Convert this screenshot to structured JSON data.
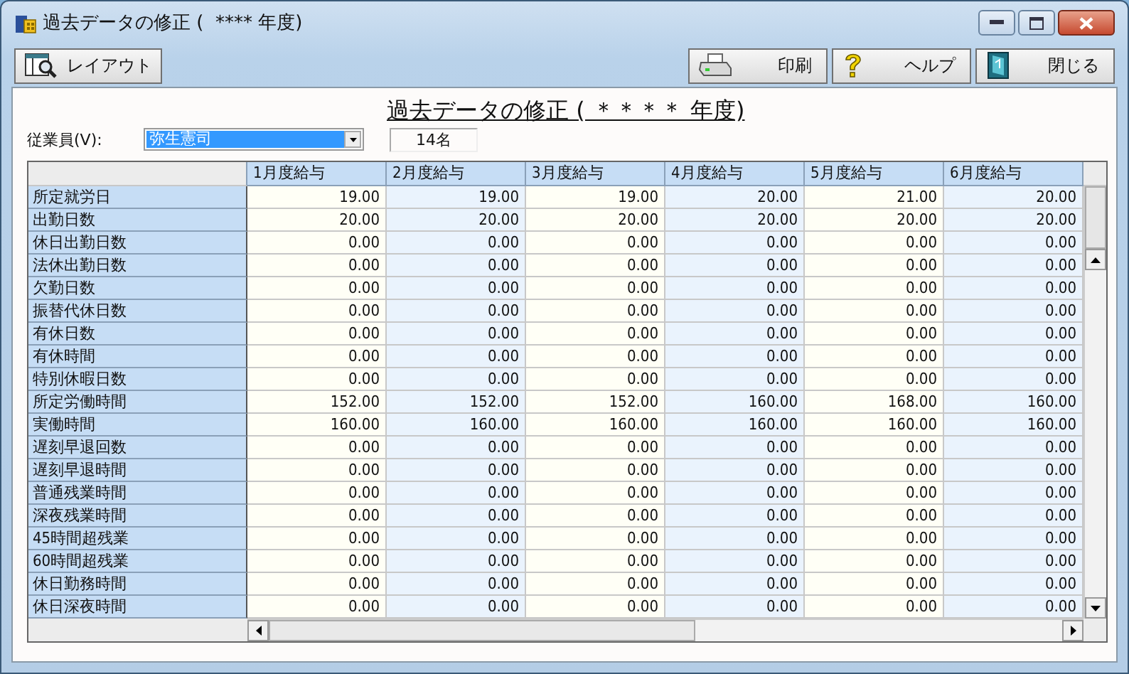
{
  "window": {
    "title": "過去データの修正 (  **** 年度)"
  },
  "toolbar": {
    "buttons": [
      {
        "kind": "layout",
        "label": "レイアウト"
      },
      {
        "kind": "print",
        "label": "印刷"
      },
      {
        "kind": "help",
        "label": "ヘルプ"
      },
      {
        "kind": "close",
        "label": "閉じる"
      }
    ]
  },
  "heading": "過去データの修正 ( ＊＊＊＊ 年度)",
  "employee": {
    "label": "従業員(V):",
    "value": "弥生憲司",
    "highlighted": true
  },
  "count": "14名",
  "table": {
    "columns": [
      "1月度給与",
      "2月度給与",
      "3月度給与",
      "4月度給与",
      "5月度給与",
      "6月度給与"
    ],
    "rows": [
      {
        "label": "所定就労日",
        "values": [
          "19.00",
          "19.00",
          "19.00",
          "20.00",
          "21.00",
          "20.00"
        ]
      },
      {
        "label": "出勤日数",
        "values": [
          "20.00",
          "20.00",
          "20.00",
          "20.00",
          "20.00",
          "20.00"
        ]
      },
      {
        "label": "休日出勤日数",
        "values": [
          "0.00",
          "0.00",
          "0.00",
          "0.00",
          "0.00",
          "0.00"
        ]
      },
      {
        "label": "法休出勤日数",
        "values": [
          "0.00",
          "0.00",
          "0.00",
          "0.00",
          "0.00",
          "0.00"
        ]
      },
      {
        "label": "欠勤日数",
        "values": [
          "0.00",
          "0.00",
          "0.00",
          "0.00",
          "0.00",
          "0.00"
        ]
      },
      {
        "label": "振替代休日数",
        "values": [
          "0.00",
          "0.00",
          "0.00",
          "0.00",
          "0.00",
          "0.00"
        ]
      },
      {
        "label": "有休日数",
        "values": [
          "0.00",
          "0.00",
          "0.00",
          "0.00",
          "0.00",
          "0.00"
        ]
      },
      {
        "label": "有休時間",
        "values": [
          "0.00",
          "0.00",
          "0.00",
          "0.00",
          "0.00",
          "0.00"
        ]
      },
      {
        "label": "特別休暇日数",
        "values": [
          "0.00",
          "0.00",
          "0.00",
          "0.00",
          "0.00",
          "0.00"
        ]
      },
      {
        "label": "所定労働時間",
        "values": [
          "152.00",
          "152.00",
          "152.00",
          "160.00",
          "168.00",
          "160.00"
        ]
      },
      {
        "label": "実働時間",
        "values": [
          "160.00",
          "160.00",
          "160.00",
          "160.00",
          "160.00",
          "160.00"
        ]
      },
      {
        "label": "遅刻早退回数",
        "values": [
          "0.00",
          "0.00",
          "0.00",
          "0.00",
          "0.00",
          "0.00"
        ]
      },
      {
        "label": "遅刻早退時間",
        "values": [
          "0.00",
          "0.00",
          "0.00",
          "0.00",
          "0.00",
          "0.00"
        ]
      },
      {
        "label": "普通残業時間",
        "values": [
          "0.00",
          "0.00",
          "0.00",
          "0.00",
          "0.00",
          "0.00"
        ]
      },
      {
        "label": "深夜残業時間",
        "values": [
          "0.00",
          "0.00",
          "0.00",
          "0.00",
          "0.00",
          "0.00"
        ]
      },
      {
        "label": "45時間超残業",
        "values": [
          "0.00",
          "0.00",
          "0.00",
          "0.00",
          "0.00",
          "0.00"
        ]
      },
      {
        "label": "60時間超残業",
        "values": [
          "0.00",
          "0.00",
          "0.00",
          "0.00",
          "0.00",
          "0.00"
        ]
      },
      {
        "label": "休日勤務時間",
        "values": [
          "0.00",
          "0.00",
          "0.00",
          "0.00",
          "0.00",
          "0.00"
        ]
      },
      {
        "label": "休日深夜時間",
        "values": [
          "0.00",
          "0.00",
          "0.00",
          "0.00",
          "0.00",
          "0.00"
        ]
      }
    ]
  }
}
